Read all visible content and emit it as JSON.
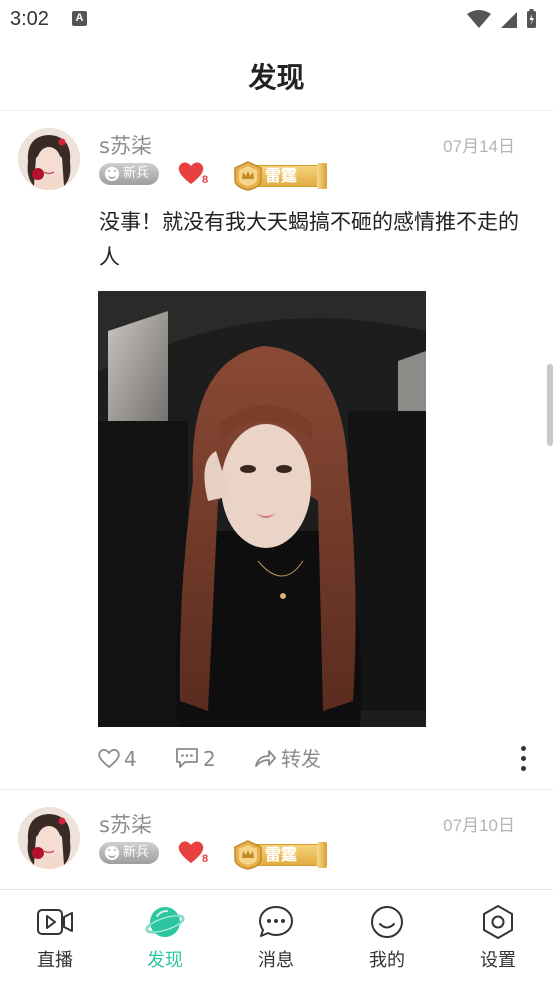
{
  "status_bar": {
    "time": "3:02",
    "notif_icon": "A"
  },
  "header": {
    "title": "发现"
  },
  "posts": [
    {
      "username": "s苏柒",
      "date": "07月14日",
      "rank_badge": "新兵",
      "heart_count": "8",
      "level_badge": "雷霆",
      "text": "没事！就没有我大天蝎搞不砸的感情推不走的人",
      "likes": "4",
      "comments": "2",
      "share_label": "转发"
    },
    {
      "username": "s苏柒",
      "date": "07月10日",
      "rank_badge": "新兵",
      "heart_count": "8",
      "level_badge": "雷霆"
    }
  ],
  "nav": {
    "items": [
      {
        "label": "直播",
        "icon": "live-video-icon"
      },
      {
        "label": "发现",
        "icon": "discover-planet-icon"
      },
      {
        "label": "消息",
        "icon": "message-icon"
      },
      {
        "label": "我的",
        "icon": "profile-smile-icon"
      },
      {
        "label": "设置",
        "icon": "settings-icon"
      }
    ],
    "active_index": 1
  },
  "colors": {
    "accent": "#2dc6a0",
    "heart": "#e84040",
    "gold": "#e2ac42"
  }
}
